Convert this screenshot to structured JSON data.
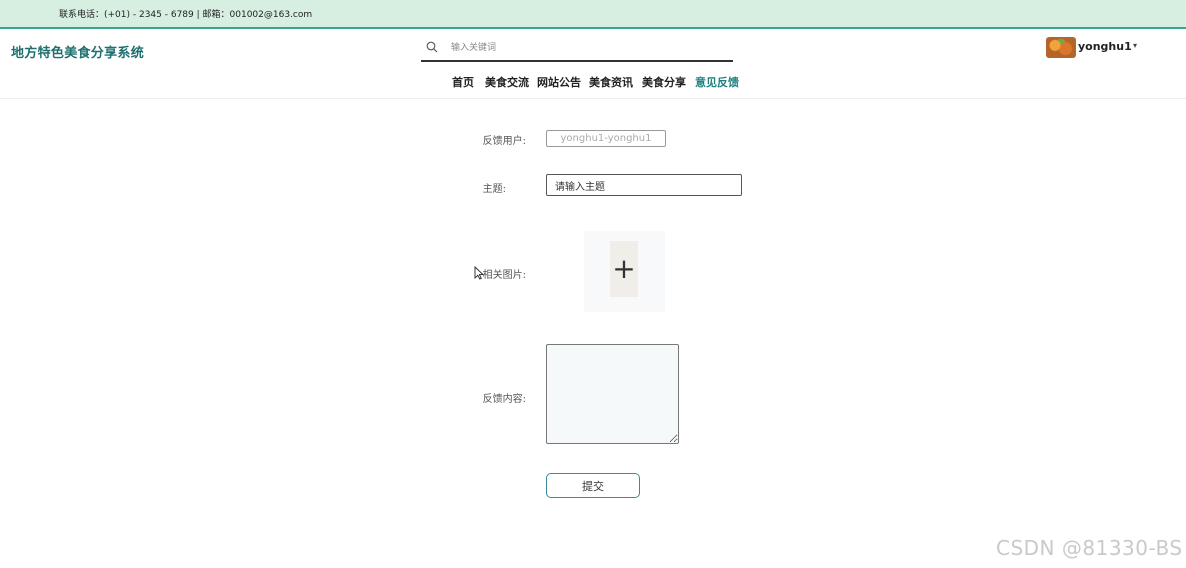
{
  "topbar": {
    "contact": "联系电话：(+01) - 2345 - 6789 | 邮箱：001002@163.com"
  },
  "header": {
    "logo": "地方特色美食分享系统",
    "search": {
      "placeholder": "输入关键词",
      "icon": "search-icon"
    },
    "user": {
      "name": "yonghu1",
      "caret": "▾"
    }
  },
  "nav": [
    {
      "label": "首页"
    },
    {
      "label": "美食交流"
    },
    {
      "label": "网站公告"
    },
    {
      "label": "美食资讯"
    },
    {
      "label": "美食分享"
    },
    {
      "label": "意见反馈",
      "active": true
    }
  ],
  "form": {
    "user_label": "反馈用户:",
    "user_value": "yonghu1-yonghu1",
    "title_label": "主题:",
    "title_value": "请输入主题",
    "image_label": "相关图片:",
    "upload_icon": "plus-icon",
    "content_label": "反馈内容:",
    "submit_label": "提交"
  },
  "watermark": "CSDN @81330-BS",
  "colors": {
    "accent": "#1f8080",
    "topbar_bg": "#d6efe1",
    "topbar_border": "#3aa58a"
  }
}
